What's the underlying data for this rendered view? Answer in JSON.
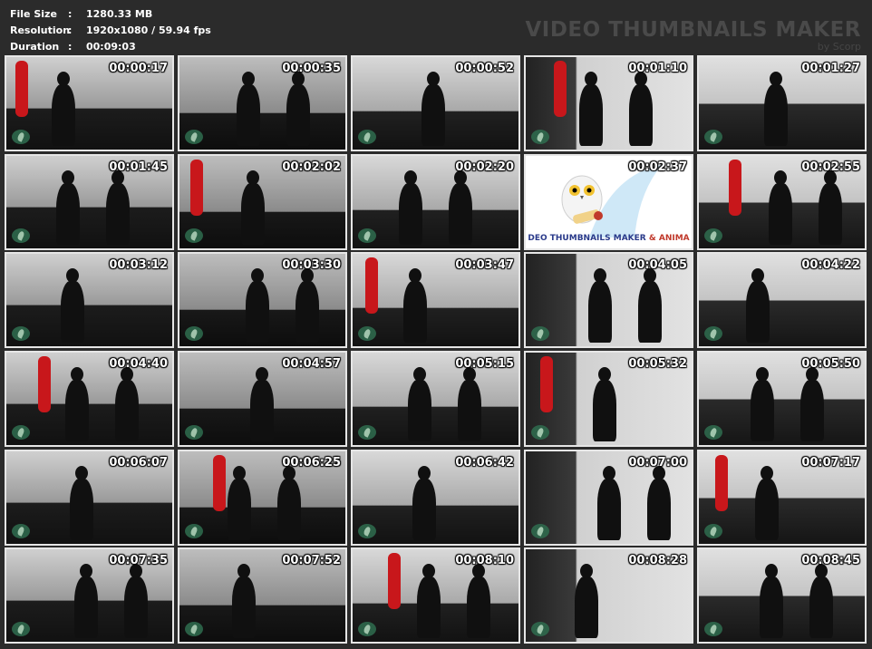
{
  "info": {
    "file_size_label": "File Size",
    "file_size_value": "1280.33 MB",
    "resolution_label": "Resolution",
    "resolution_value": "1920x1080 / 59.94 fps",
    "duration_label": "Duration",
    "duration_value": "00:09:03",
    "separator": ":"
  },
  "watermark": {
    "title": "VIDEO THUMBNAILS MAKER",
    "byline": "by Scorp"
  },
  "promo": {
    "text_part1": "DEO THUMBNAILS MAKER",
    "text_part2": " & ANIMA"
  },
  "thumbnails": [
    {
      "time": "00:00:17"
    },
    {
      "time": "00:00:35"
    },
    {
      "time": "00:00:52"
    },
    {
      "time": "00:01:10"
    },
    {
      "time": "00:01:27"
    },
    {
      "time": "00:01:45"
    },
    {
      "time": "00:02:02"
    },
    {
      "time": "00:02:20"
    },
    {
      "time": "00:02:37"
    },
    {
      "time": "00:02:55"
    },
    {
      "time": "00:03:12"
    },
    {
      "time": "00:03:30"
    },
    {
      "time": "00:03:47"
    },
    {
      "time": "00:04:05"
    },
    {
      "time": "00:04:22"
    },
    {
      "time": "00:04:40"
    },
    {
      "time": "00:04:57"
    },
    {
      "time": "00:05:15"
    },
    {
      "time": "00:05:32"
    },
    {
      "time": "00:05:50"
    },
    {
      "time": "00:06:07"
    },
    {
      "time": "00:06:25"
    },
    {
      "time": "00:06:42"
    },
    {
      "time": "00:07:00"
    },
    {
      "time": "00:07:17"
    },
    {
      "time": "00:07:35"
    },
    {
      "time": "00:07:52"
    },
    {
      "time": "00:08:10"
    },
    {
      "time": "00:08:28"
    },
    {
      "time": "00:08:45"
    }
  ],
  "colors": {
    "background": "#2b2b2b",
    "thumb_border": "#e6e6e6",
    "bag_red": "#c8171b",
    "logo_green": "#2f6d4f"
  }
}
